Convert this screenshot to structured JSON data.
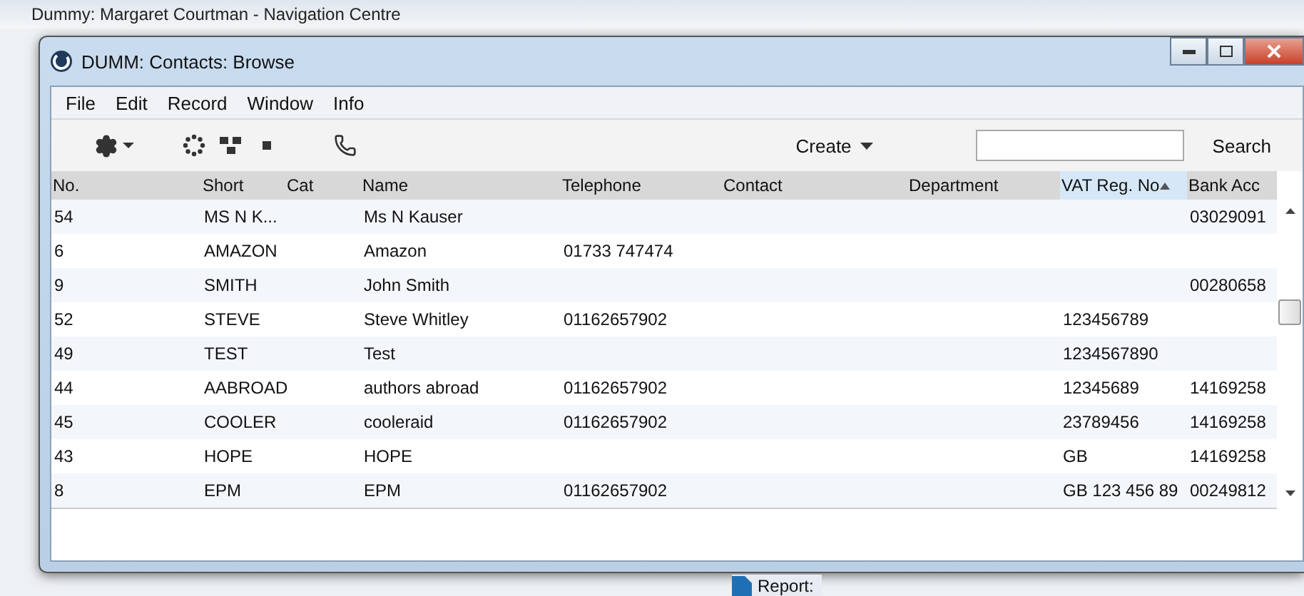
{
  "background_window": {
    "title": "Dummy: Margaret Courtman - Navigation Centre",
    "report_label": "Report:"
  },
  "window": {
    "title": "DUMM: Contacts: Browse"
  },
  "menu": [
    "File",
    "Edit",
    "Record",
    "Window",
    "Info"
  ],
  "toolbar": {
    "create": "Create",
    "search_button": "Search"
  },
  "table": {
    "columns": [
      {
        "label": "No.",
        "sorted": false
      },
      {
        "label": "Short",
        "sorted": false
      },
      {
        "label": "Cat",
        "sorted": false
      },
      {
        "label": "Name",
        "sorted": false
      },
      {
        "label": "Telephone",
        "sorted": false
      },
      {
        "label": "Contact",
        "sorted": false
      },
      {
        "label": "Department",
        "sorted": false
      },
      {
        "label": "VAT Reg. No",
        "sorted": true
      },
      {
        "label": "Bank Acc",
        "sorted": false
      }
    ],
    "rows": [
      [
        "54",
        "MS N K...",
        null,
        "Ms N Kauser",
        null,
        null,
        null,
        null,
        "03029091"
      ],
      [
        "6",
        "AMAZON",
        null,
        "Amazon",
        "01733 747474",
        null,
        null,
        null,
        null
      ],
      [
        "9",
        "SMITH",
        null,
        "John Smith",
        null,
        null,
        null,
        null,
        "00280658"
      ],
      [
        "52",
        "STEVE",
        null,
        "Steve Whitley",
        "01162657902",
        null,
        null,
        "123456789",
        null
      ],
      [
        "49",
        "TEST",
        null,
        "Test",
        null,
        null,
        null,
        "1234567890",
        null
      ],
      [
        "44",
        "AABROAD",
        null,
        "authors abroad",
        "01162657902",
        null,
        null,
        "12345689",
        "14169258"
      ],
      [
        "45",
        "COOLER",
        null,
        "cooleraid",
        "01162657902",
        null,
        null,
        "23789456",
        "14169258"
      ],
      [
        "43",
        "HOPE",
        null,
        "HOPE",
        null,
        null,
        null,
        "GB",
        "14169258"
      ],
      [
        "8",
        "EPM",
        null,
        "EPM",
        "01162657902",
        null,
        null,
        "GB 123 456 89",
        "00249812"
      ]
    ]
  }
}
